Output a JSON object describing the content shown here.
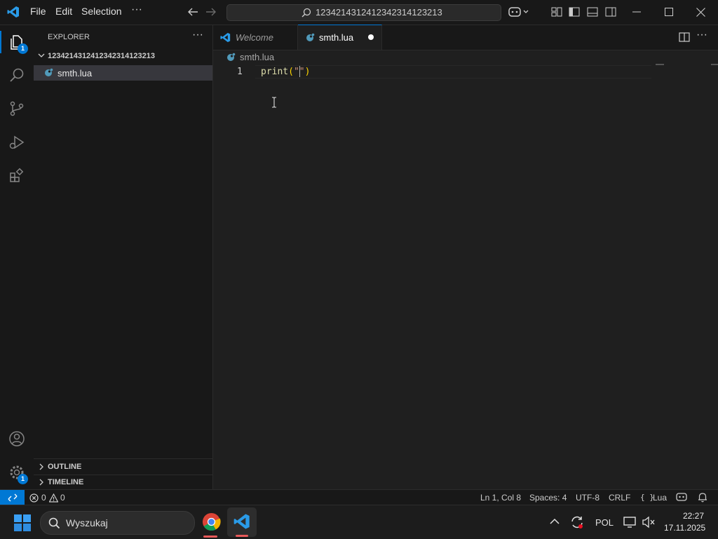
{
  "titlebar": {
    "menu": [
      "File",
      "Edit",
      "Selection"
    ],
    "search_text": "12342143124123423141232​13"
  },
  "activity": {
    "explorer_badge": "1",
    "settings_badge": "1"
  },
  "sidebar": {
    "title": "EXPLORER",
    "folder_name": "12342143124123423141232​13",
    "files": [
      "smth.lua"
    ],
    "outline_label": "OUTLINE",
    "timeline_label": "TIMELINE"
  },
  "tabs": [
    {
      "label": "Welcome"
    },
    {
      "label": "smth.lua"
    }
  ],
  "breadcrumb": "smth.lua",
  "editor": {
    "line_number": "1",
    "code_func": "print",
    "code_open": "(",
    "code_quote": "\"\"",
    "code_close": ")"
  },
  "statusbar": {
    "errors": "0",
    "warnings": "0",
    "position": "Ln 1, Col 8",
    "spaces": "Spaces: 4",
    "encoding": "UTF-8",
    "eol": "CRLF",
    "language_icon": "{ }",
    "language": "Lua"
  },
  "taskbar": {
    "search_placeholder": "Wyszukaj",
    "language": "POL",
    "time": "22:27",
    "date": "17.11.2025"
  },
  "colors": {
    "accent": "#0078d4",
    "lua_icon": "#519aba",
    "code_func": "#dcdcaa",
    "code_string": "#ce9178",
    "code_bracket": "#ffd700"
  }
}
